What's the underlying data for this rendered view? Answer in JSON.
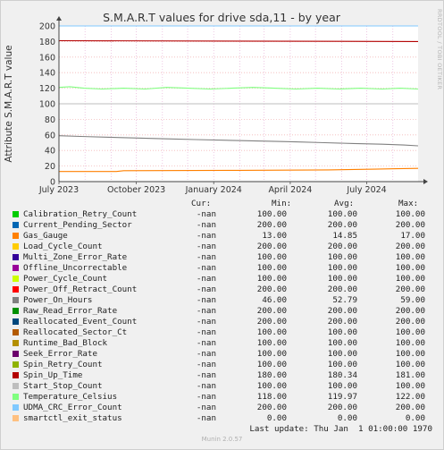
{
  "chart_data": {
    "type": "line",
    "title": "S.M.A.R.T values for drive sda,11 - by year",
    "ylabel": "Attribute S.M.A.R.T value",
    "xlabel": "",
    "ylim": [
      0,
      200
    ],
    "y_ticks": [
      0,
      20,
      40,
      60,
      80,
      100,
      120,
      140,
      160,
      180,
      200
    ],
    "x_ticks": [
      "July 2023",
      "October 2023",
      "January 2024",
      "April 2024",
      "July 2024"
    ],
    "x_range": [
      "2023-07-01",
      "2024-08-31"
    ],
    "grid": true,
    "series": [
      {
        "name": "Calibration_Retry_Count",
        "color": "#00cc00",
        "values": [
          [
            0,
            100
          ],
          [
            1,
            100
          ]
        ]
      },
      {
        "name": "Current_Pending_Sector",
        "color": "#0066b3",
        "values": [
          [
            0,
            200
          ],
          [
            1,
            200
          ]
        ]
      },
      {
        "name": "Gas_Gauge",
        "color": "#ff8000",
        "values": [
          [
            0,
            13
          ],
          [
            0.16,
            13
          ],
          [
            0.18,
            14
          ],
          [
            0.5,
            14.5
          ],
          [
            0.75,
            15
          ],
          [
            0.88,
            16
          ],
          [
            0.94,
            16.5
          ],
          [
            1,
            17
          ]
        ]
      },
      {
        "name": "Load_Cycle_Count",
        "color": "#ffcc00",
        "values": [
          [
            0,
            200
          ],
          [
            1,
            200
          ]
        ]
      },
      {
        "name": "Multi_Zone_Error_Rate",
        "color": "#330099",
        "values": [
          [
            0,
            100
          ],
          [
            1,
            100
          ]
        ]
      },
      {
        "name": "Offline_Uncorrectable",
        "color": "#990099",
        "values": [
          [
            0,
            100
          ],
          [
            1,
            100
          ]
        ]
      },
      {
        "name": "Power_Cycle_Count",
        "color": "#ccff00",
        "values": [
          [
            0,
            100
          ],
          [
            1,
            100
          ]
        ]
      },
      {
        "name": "Power_Off_Retract_Count",
        "color": "#ff0000",
        "values": [
          [
            0,
            200
          ],
          [
            1,
            200
          ]
        ]
      },
      {
        "name": "Power_On_Hours",
        "color": "#808080",
        "values": [
          [
            0,
            59
          ],
          [
            0.06,
            58
          ],
          [
            0.14,
            57
          ],
          [
            0.22,
            56
          ],
          [
            0.3,
            55
          ],
          [
            0.38,
            54
          ],
          [
            0.48,
            53
          ],
          [
            0.58,
            52
          ],
          [
            0.66,
            51
          ],
          [
            0.74,
            50
          ],
          [
            0.82,
            49
          ],
          [
            0.9,
            48
          ],
          [
            0.96,
            47
          ],
          [
            1,
            46
          ]
        ]
      },
      {
        "name": "Raw_Read_Error_Rate",
        "color": "#008f00",
        "values": [
          [
            0,
            200
          ],
          [
            1,
            200
          ]
        ]
      },
      {
        "name": "Reallocated_Event_Count",
        "color": "#00487d",
        "values": [
          [
            0,
            200
          ],
          [
            1,
            200
          ]
        ]
      },
      {
        "name": "Reallocated_Sector_Ct",
        "color": "#b35a00",
        "values": [
          [
            0,
            100
          ],
          [
            1,
            100
          ]
        ]
      },
      {
        "name": "Runtime_Bad_Block",
        "color": "#b38f00",
        "values": [
          [
            0,
            100
          ],
          [
            1,
            100
          ]
        ]
      },
      {
        "name": "Seek_Error_Rate",
        "color": "#6b006b",
        "values": [
          [
            0,
            100
          ],
          [
            1,
            100
          ]
        ]
      },
      {
        "name": "Spin_Retry_Count",
        "color": "#8fb300",
        "values": [
          [
            0,
            100
          ],
          [
            1,
            100
          ]
        ]
      },
      {
        "name": "Spin_Up_Time",
        "color": "#b30000",
        "values": [
          [
            0,
            181
          ],
          [
            1,
            180
          ]
        ]
      },
      {
        "name": "Start_Stop_Count",
        "color": "#bebebe",
        "values": [
          [
            0,
            100
          ],
          [
            1,
            100
          ]
        ]
      },
      {
        "name": "Temperature_Celsius",
        "color": "#80ff80",
        "values": [
          [
            0,
            121
          ],
          [
            0.03,
            122
          ],
          [
            0.07,
            120
          ],
          [
            0.12,
            119
          ],
          [
            0.18,
            120
          ],
          [
            0.24,
            119
          ],
          [
            0.3,
            121
          ],
          [
            0.36,
            120
          ],
          [
            0.42,
            119
          ],
          [
            0.48,
            120
          ],
          [
            0.54,
            121
          ],
          [
            0.6,
            120
          ],
          [
            0.66,
            119
          ],
          [
            0.72,
            120
          ],
          [
            0.78,
            119
          ],
          [
            0.84,
            120
          ],
          [
            0.9,
            119
          ],
          [
            0.95,
            120
          ],
          [
            1,
            119
          ]
        ]
      },
      {
        "name": "UDMA_CRC_Error_Count",
        "color": "#80c9ff",
        "values": [
          [
            0,
            200
          ],
          [
            1,
            200
          ]
        ]
      },
      {
        "name": "smartctl_exit_status",
        "color": "#ffc080",
        "values": [
          [
            0,
            0
          ],
          [
            1,
            0
          ]
        ]
      }
    ]
  },
  "legend": {
    "headers": {
      "cur": "Cur:",
      "min": "Min:",
      "avg": "Avg:",
      "max": "Max:"
    },
    "rows": [
      {
        "name": "Calibration_Retry_Count",
        "cur": "-nan",
        "min": "100.00",
        "avg": "100.00",
        "max": "100.00"
      },
      {
        "name": "Current_Pending_Sector",
        "cur": "-nan",
        "min": "200.00",
        "avg": "200.00",
        "max": "200.00"
      },
      {
        "name": "Gas_Gauge",
        "cur": "-nan",
        "min": "13.00",
        "avg": "14.85",
        "max": "17.00"
      },
      {
        "name": "Load_Cycle_Count",
        "cur": "-nan",
        "min": "200.00",
        "avg": "200.00",
        "max": "200.00"
      },
      {
        "name": "Multi_Zone_Error_Rate",
        "cur": "-nan",
        "min": "100.00",
        "avg": "100.00",
        "max": "100.00"
      },
      {
        "name": "Offline_Uncorrectable",
        "cur": "-nan",
        "min": "100.00",
        "avg": "100.00",
        "max": "100.00"
      },
      {
        "name": "Power_Cycle_Count",
        "cur": "-nan",
        "min": "100.00",
        "avg": "100.00",
        "max": "100.00"
      },
      {
        "name": "Power_Off_Retract_Count",
        "cur": "-nan",
        "min": "200.00",
        "avg": "200.00",
        "max": "200.00"
      },
      {
        "name": "Power_On_Hours",
        "cur": "-nan",
        "min": "46.00",
        "avg": "52.79",
        "max": "59.00"
      },
      {
        "name": "Raw_Read_Error_Rate",
        "cur": "-nan",
        "min": "200.00",
        "avg": "200.00",
        "max": "200.00"
      },
      {
        "name": "Reallocated_Event_Count",
        "cur": "-nan",
        "min": "200.00",
        "avg": "200.00",
        "max": "200.00"
      },
      {
        "name": "Reallocated_Sector_Ct",
        "cur": "-nan",
        "min": "100.00",
        "avg": "100.00",
        "max": "100.00"
      },
      {
        "name": "Runtime_Bad_Block",
        "cur": "-nan",
        "min": "100.00",
        "avg": "100.00",
        "max": "100.00"
      },
      {
        "name": "Seek_Error_Rate",
        "cur": "-nan",
        "min": "100.00",
        "avg": "100.00",
        "max": "100.00"
      },
      {
        "name": "Spin_Retry_Count",
        "cur": "-nan",
        "min": "100.00",
        "avg": "100.00",
        "max": "100.00"
      },
      {
        "name": "Spin_Up_Time",
        "cur": "-nan",
        "min": "180.00",
        "avg": "180.34",
        "max": "181.00"
      },
      {
        "name": "Start_Stop_Count",
        "cur": "-nan",
        "min": "100.00",
        "avg": "100.00",
        "max": "100.00"
      },
      {
        "name": "Temperature_Celsius",
        "cur": "-nan",
        "min": "118.00",
        "avg": "119.97",
        "max": "122.00"
      },
      {
        "name": "UDMA_CRC_Error_Count",
        "cur": "-nan",
        "min": "200.00",
        "avg": "200.00",
        "max": "200.00"
      },
      {
        "name": "smartctl_exit_status",
        "cur": "-nan",
        "min": "0.00",
        "avg": "0.00",
        "max": "0.00"
      }
    ]
  },
  "footer": {
    "last_update": "Last update: Thu Jan  1 01:00:00 1970",
    "munin_version": "Munin 2.0.57"
  },
  "watermark": "RRDTOOL / TOBI OETIKER"
}
